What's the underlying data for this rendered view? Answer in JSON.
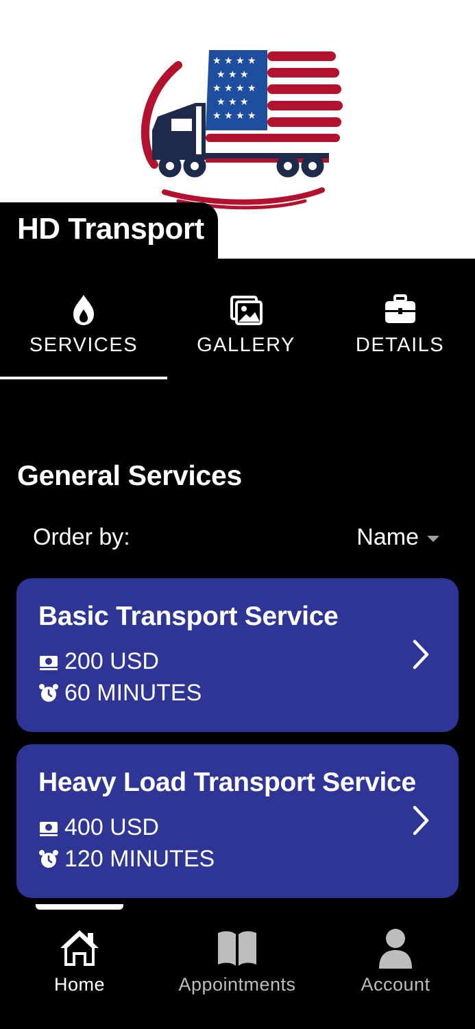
{
  "business": {
    "name": "HD Transport",
    "logo_icon": "truck-flag-logo"
  },
  "tabs": [
    {
      "label": "SERVICES",
      "icon": "fire-icon",
      "selected": true
    },
    {
      "label": "GALLERY",
      "icon": "image-icon",
      "selected": false
    },
    {
      "label": "DETAILS",
      "icon": "briefcase-icon",
      "selected": false
    }
  ],
  "section": {
    "title": "General Services",
    "order_label": "Order by:",
    "order_value": "Name"
  },
  "services": [
    {
      "name": "Basic Transport Service",
      "price": "200 USD",
      "duration": "60 MINUTES"
    },
    {
      "name": "Heavy Load Transport Service",
      "price": "400 USD",
      "duration": "120 MINUTES"
    }
  ],
  "bottom_nav": [
    {
      "label": "Home",
      "icon": "home-icon",
      "active": true
    },
    {
      "label": "Appointments",
      "icon": "book-icon",
      "active": false
    },
    {
      "label": "Account",
      "icon": "user-icon",
      "active": false
    }
  ],
  "colors": {
    "card_bg": "#2f3595",
    "flag_red": "#b3122e",
    "flag_blue": "#1f4e9e",
    "truck_navy": "#1e2a4a"
  }
}
